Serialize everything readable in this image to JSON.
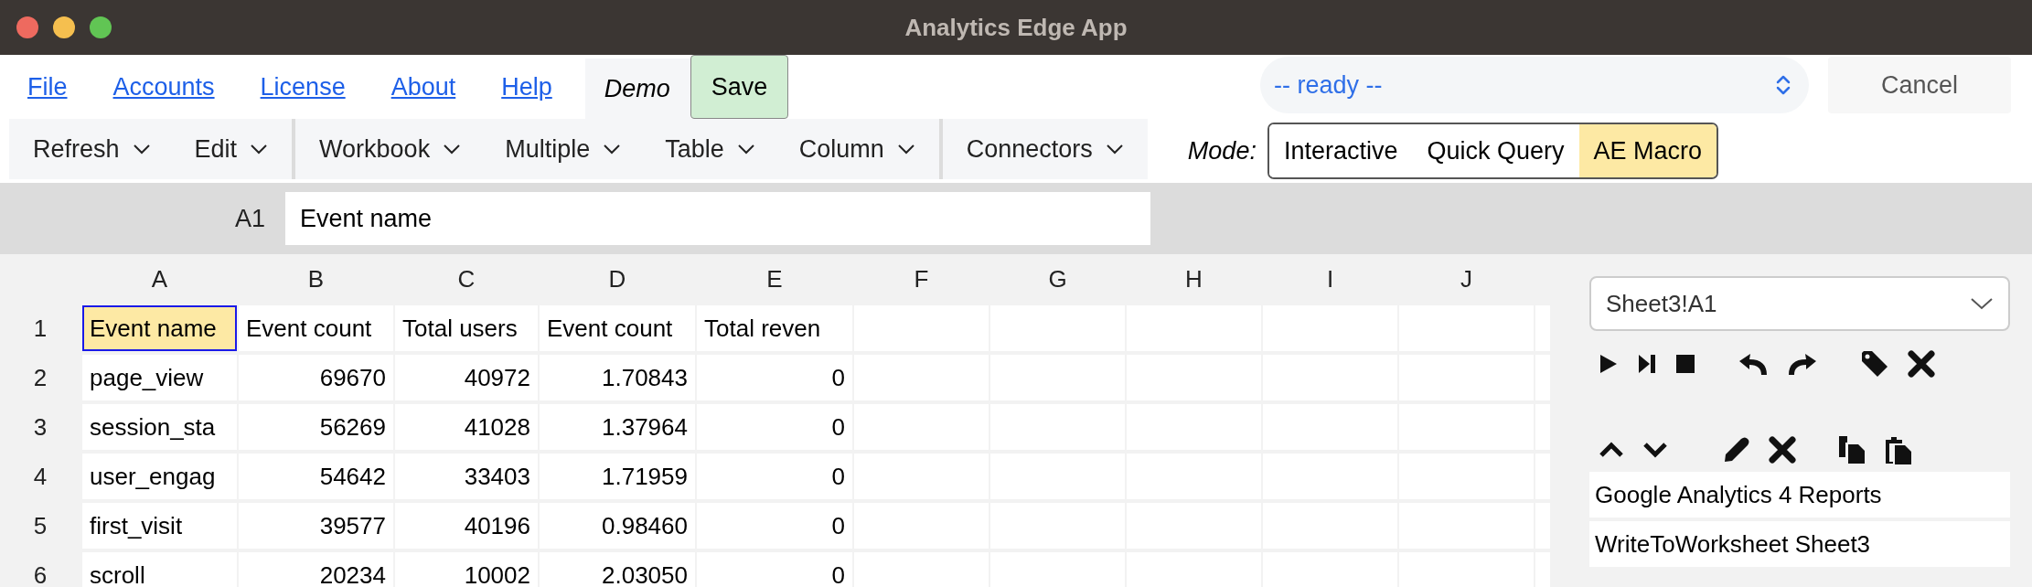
{
  "window": {
    "title": "Analytics Edge App"
  },
  "menu": [
    "File",
    "Accounts",
    "License",
    "About",
    "Help"
  ],
  "demo_label": "Demo",
  "save_button": "Save",
  "status": {
    "value": "-- ready --"
  },
  "cancel_button": "Cancel",
  "toolbar_groups": [
    [
      "Refresh",
      "Edit"
    ],
    [
      "Workbook",
      "Multiple",
      "Table",
      "Column"
    ],
    [
      "Connectors"
    ]
  ],
  "mode": {
    "label": "Mode:",
    "options": [
      {
        "label": "Interactive",
        "selected": false
      },
      {
        "label": "Quick Query",
        "selected": false
      },
      {
        "label": "AE Macro",
        "selected": true
      }
    ]
  },
  "formula_bar": {
    "cell_ref": "A1",
    "value": "Event name"
  },
  "sheet": {
    "columns": [
      "A",
      "B",
      "C",
      "D",
      "E",
      "F",
      "G",
      "H",
      "I",
      "J"
    ],
    "rows": [
      {
        "number": "1",
        "cells": [
          {
            "text": "Event name",
            "selected": true
          },
          {
            "text": "Event count",
            "selected": false
          },
          {
            "text": "Total users",
            "selected": false
          },
          {
            "text": "Event count",
            "selected": false
          },
          {
            "text": "Total reven",
            "selected": false
          }
        ]
      },
      {
        "number": "2",
        "cells": [
          {
            "text": "page_view",
            "selected": false
          },
          {
            "text": "69670",
            "selected": false
          },
          {
            "text": "40972",
            "selected": false
          },
          {
            "text": "1.70843",
            "selected": false
          },
          {
            "text": "0",
            "selected": false
          }
        ]
      },
      {
        "number": "3",
        "cells": [
          {
            "text": "session_sta",
            "selected": false
          },
          {
            "text": "56269",
            "selected": false
          },
          {
            "text": "41028",
            "selected": false
          },
          {
            "text": "1.37964",
            "selected": false
          },
          {
            "text": "0",
            "selected": false
          }
        ]
      },
      {
        "number": "4",
        "cells": [
          {
            "text": "user_engag",
            "selected": false
          },
          {
            "text": "54642",
            "selected": false
          },
          {
            "text": "33403",
            "selected": false
          },
          {
            "text": "1.71959",
            "selected": false
          },
          {
            "text": "0",
            "selected": false
          }
        ]
      },
      {
        "number": "5",
        "cells": [
          {
            "text": "first_visit",
            "selected": false
          },
          {
            "text": "39577",
            "selected": false
          },
          {
            "text": "40196",
            "selected": false
          },
          {
            "text": "0.98460",
            "selected": false
          },
          {
            "text": "0",
            "selected": false
          }
        ]
      },
      {
        "number": "6",
        "cells": [
          {
            "text": "scroll",
            "selected": false
          },
          {
            "text": "20234",
            "selected": false
          },
          {
            "text": "10002",
            "selected": false
          },
          {
            "text": "2.03050",
            "selected": false
          },
          {
            "text": "0",
            "selected": false
          }
        ]
      }
    ]
  },
  "macro_panel": {
    "target": "Sheet3!A1",
    "steps": [
      "Google Analytics 4 Reports",
      "WriteToWorksheet Sheet3"
    ]
  }
}
